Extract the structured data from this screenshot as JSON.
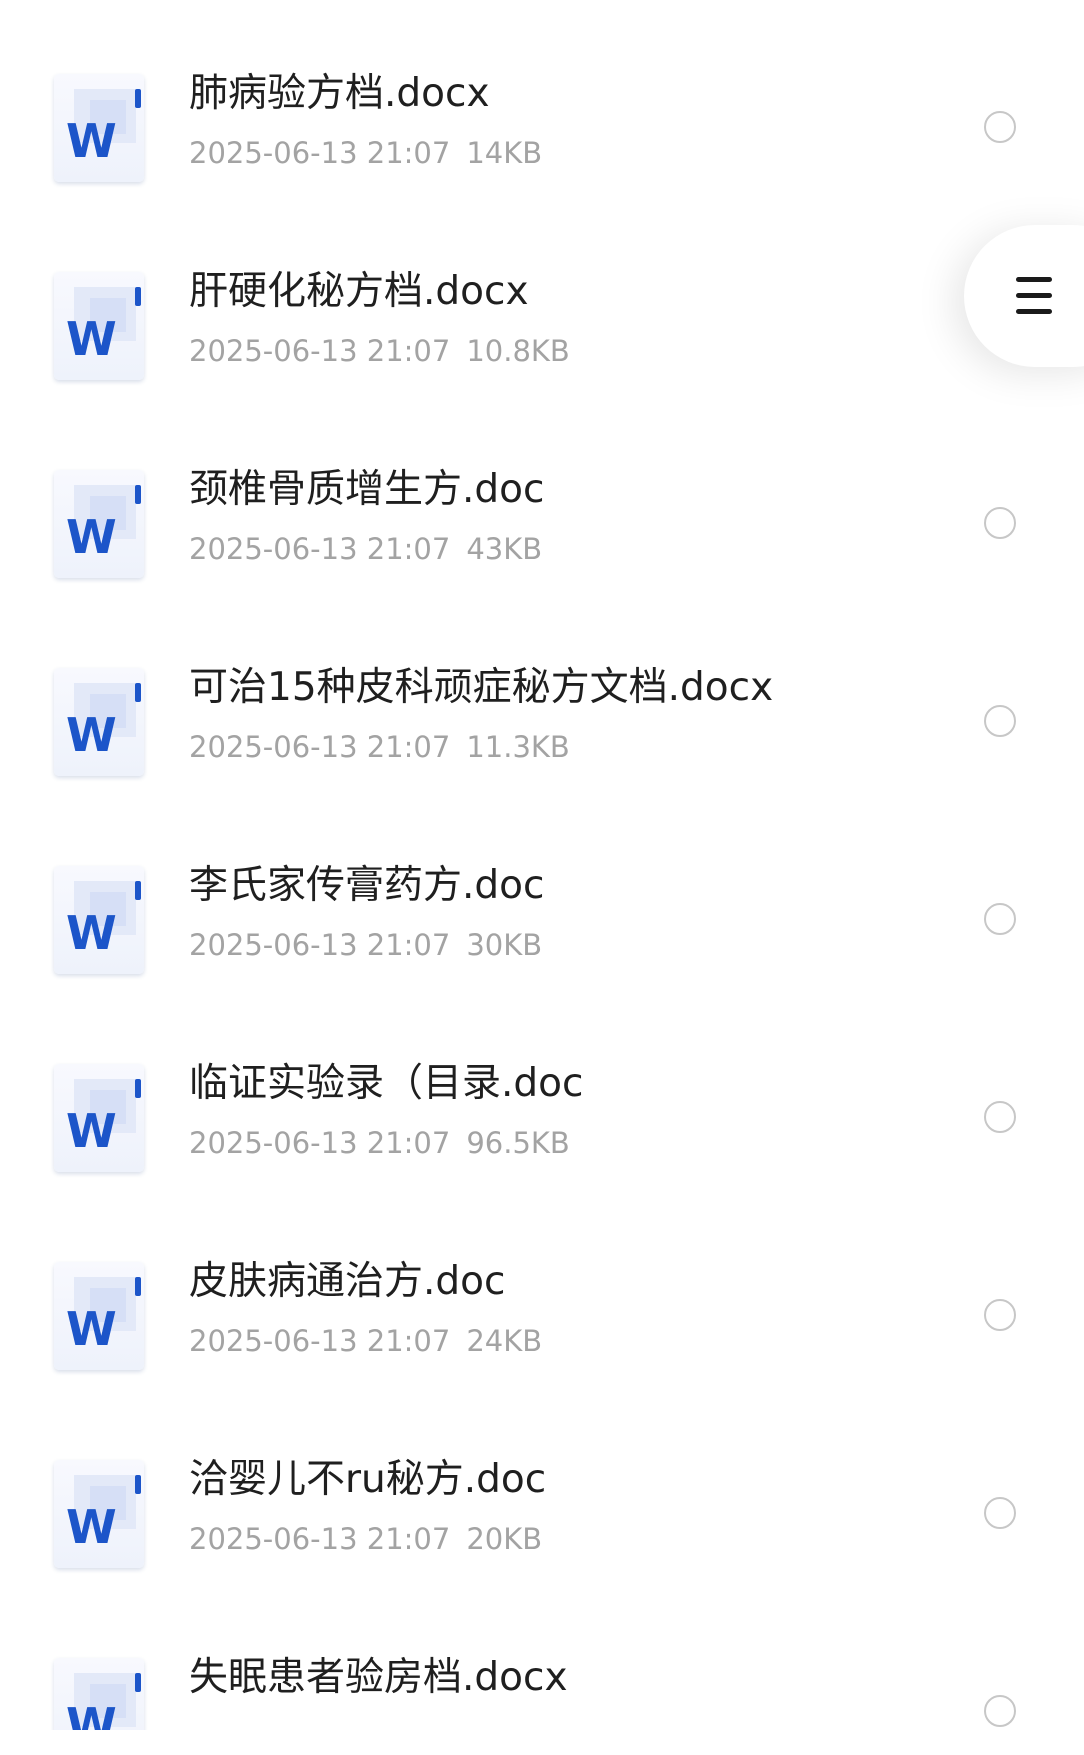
{
  "files": [
    {
      "name": "肺病验方档.docx",
      "date": "2025-06-13 21:07",
      "size": "14KB",
      "icon": "word-doc-icon",
      "icon_letter": "W",
      "selected": false
    },
    {
      "name": "肝硬化秘方档.docx",
      "date": "2025-06-13 21:07",
      "size": "10.8KB",
      "icon": "word-doc-icon",
      "icon_letter": "W",
      "selected": false
    },
    {
      "name": "颈椎骨质增生方.doc",
      "date": "2025-06-13 21:07",
      "size": "43KB",
      "icon": "word-doc-icon",
      "icon_letter": "W",
      "selected": false
    },
    {
      "name": "可治15种皮科顽症秘方文档.docx",
      "date": "2025-06-13 21:07",
      "size": "11.3KB",
      "icon": "word-doc-icon",
      "icon_letter": "W",
      "selected": false
    },
    {
      "name": "李氏家传膏药方.doc",
      "date": "2025-06-13 21:07",
      "size": "30KB",
      "icon": "word-doc-icon",
      "icon_letter": "W",
      "selected": false
    },
    {
      "name": "临证实验录（目录.doc",
      "date": "2025-06-13 21:07",
      "size": "96.5KB",
      "icon": "word-doc-icon",
      "icon_letter": "W",
      "selected": false
    },
    {
      "name": "皮肤病通治方.doc",
      "date": "2025-06-13 21:07",
      "size": "24KB",
      "icon": "word-doc-icon",
      "icon_letter": "W",
      "selected": false
    },
    {
      "name": "洽婴儿不ru秘方.doc",
      "date": "2025-06-13 21:07",
      "size": "20KB",
      "icon": "word-doc-icon",
      "icon_letter": "W",
      "selected": false
    },
    {
      "name": "失眠患者验房档.docx",
      "date": "",
      "size": "",
      "icon": "word-doc-icon",
      "icon_letter": "W",
      "selected": false
    }
  ],
  "menu_button": {
    "icon": "hamburger-menu-icon"
  },
  "colors": {
    "word_blue": "#1c55c9",
    "title_text": "#1f1f1f",
    "meta_text": "#a3a3a3",
    "radio_border": "#c7c7c7",
    "background": "#ffffff"
  }
}
